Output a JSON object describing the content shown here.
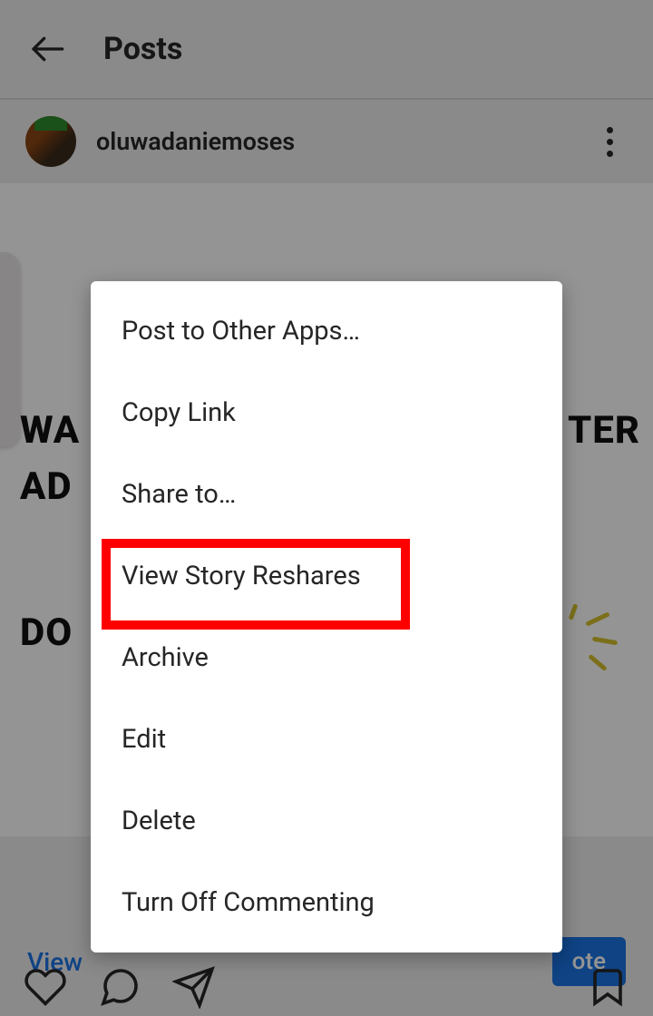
{
  "header": {
    "title": "Posts"
  },
  "post": {
    "username": "oluwadaniemoses",
    "text_fragment_1": "WA",
    "text_fragment_1b": "TER",
    "text_fragment_2": "AD",
    "text_fragment_3": "DO"
  },
  "actions": {
    "view_link": "View",
    "promote": "ote"
  },
  "menu": {
    "items": [
      "Post to Other Apps…",
      "Copy Link",
      "Share to…",
      "View Story Reshares",
      "Archive",
      "Edit",
      "Delete",
      "Turn Off Commenting"
    ]
  }
}
